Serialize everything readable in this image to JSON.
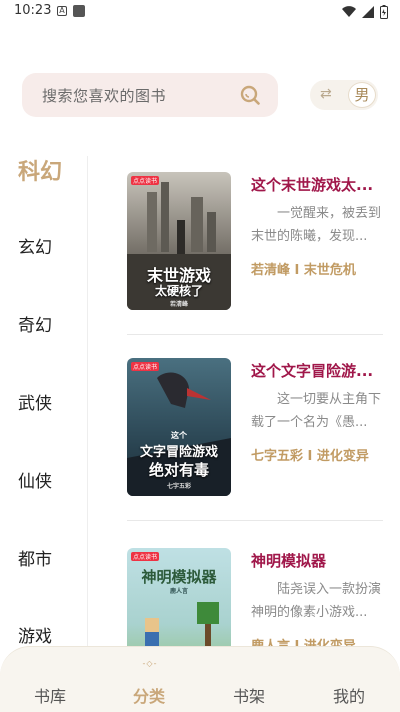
{
  "status_bar": {
    "time": "10:23",
    "a_icon": "A"
  },
  "search": {
    "placeholder": "搜索您喜欢的图书"
  },
  "gender": {
    "swap_glyph": "⇄",
    "selected": "男"
  },
  "categories": [
    "科幻",
    "玄幻",
    "奇幻",
    "武侠",
    "仙侠",
    "都市",
    "游戏"
  ],
  "active_category_index": 0,
  "books": [
    {
      "title": "这个末世游戏太...",
      "description": "一觉醒来，被丢到末世的陈曦，发现...",
      "meta": "若清峰 I 末世危机",
      "cover": {
        "tag": "点点读书",
        "title_line1": "末世游戏",
        "title_line2": "太硬核了",
        "author": "若清峰",
        "bg_top": "#c8c4bb",
        "bg_bottom": "#3c3a36",
        "title_color": "#ffffff"
      }
    },
    {
      "title": "这个文字冒险游...",
      "description": "这一切要从主角下载了一个名为《愚...",
      "meta": "七字五彩 I 进化变异",
      "cover": {
        "tag": "点点读书",
        "title_line1": "这个",
        "title_line2": "文字冒险游戏",
        "title_line3": "绝对有毒",
        "author": "七字五彩",
        "bg_top": "#4a7080",
        "bg_bottom": "#1a2a35",
        "title_color": "#ffffff"
      }
    },
    {
      "title": "神明模拟器",
      "description": "陆尧误入一款扮演神明的像素小游戏...",
      "meta": "鹿人言 I 进化变异",
      "cover": {
        "tag": "点点读书",
        "title_line1": "神明模拟器",
        "author": "鹿人言",
        "bg_top": "#bfe0e4",
        "bg_bottom": "#8fbf7a",
        "title_color": "#2c5a3a"
      }
    }
  ],
  "nav": {
    "items": [
      "书库",
      "分类",
      "书架",
      "我的"
    ],
    "active_index": 1,
    "indicator": "-◇-"
  },
  "colors": {
    "accent": "#c9a77a",
    "title_red": "#a0174a",
    "meta_gold": "#c19b63",
    "search_bg": "#f7ecea"
  }
}
